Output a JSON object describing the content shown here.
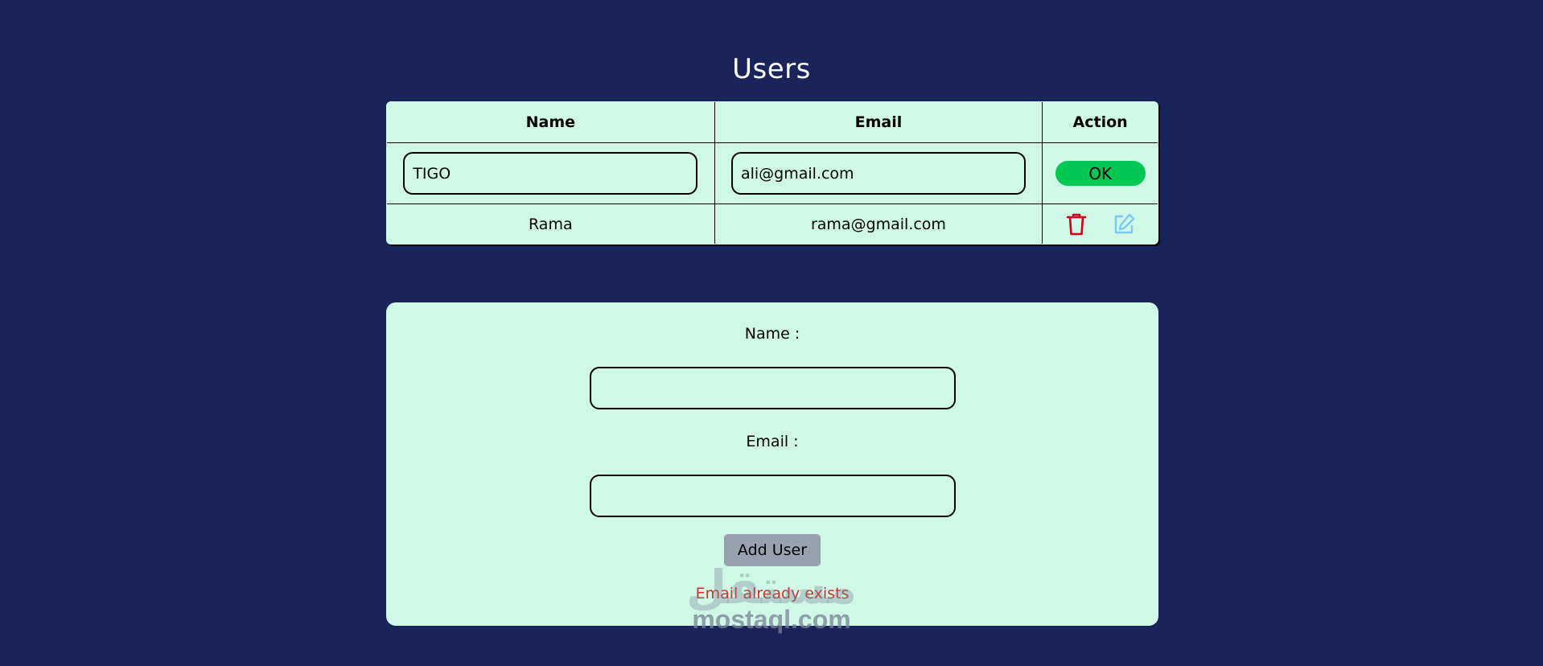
{
  "page": {
    "title": "Users"
  },
  "table": {
    "headers": {
      "name": "Name",
      "email": "Email",
      "action": "Action"
    },
    "edit_row": {
      "name_value": "TIGO",
      "email_value": "ali@gmail.com",
      "ok_label": "OK"
    },
    "rows": [
      {
        "name": "Rama",
        "email": "rama@gmail.com",
        "actions": [
          "trash-icon",
          "edit-icon"
        ]
      }
    ]
  },
  "form": {
    "name_label": "Name :",
    "name_value": "",
    "email_label": "Email :",
    "email_value": "",
    "add_label": "Add User",
    "error_message": "Email already exists"
  },
  "watermark": {
    "arabic": "مستقل",
    "text": "mostaql.com"
  },
  "colors": {
    "background": "#19245a",
    "panel": "#cff8e6",
    "ok_button": "#00c853",
    "add_button": "#9aa1ae",
    "error": "#d32f2f",
    "trash_icon": "#d0021b",
    "edit_icon": "#7ec8f5"
  }
}
